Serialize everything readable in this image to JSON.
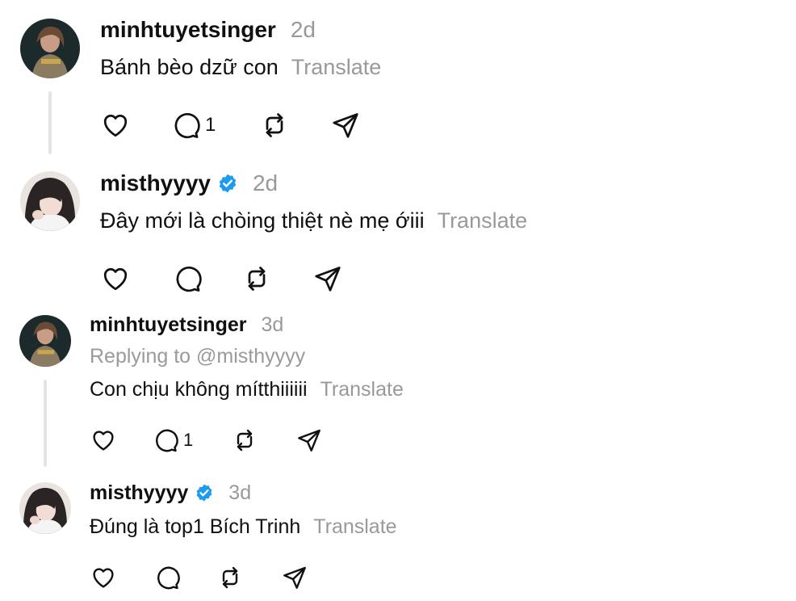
{
  "comments": [
    {
      "username": "minhtuyetsinger",
      "verified": false,
      "time": "2d",
      "text": "Bánh bèo dzữ con",
      "translate": "Translate",
      "reply_count": "1"
    },
    {
      "username": "misthyyyy",
      "verified": true,
      "time": "2d",
      "text": "Đây mới là chòing thiệt nè mẹ ớiii",
      "translate": "Translate",
      "reply_count": ""
    },
    {
      "username": "minhtuyetsinger",
      "verified": false,
      "time": "3d",
      "replying_to": "Replying to @misthyyyy",
      "text": "Con chịu không mítthiiiiii",
      "translate": "Translate",
      "reply_count": "1"
    },
    {
      "username": "misthyyyy",
      "verified": true,
      "time": "3d",
      "text": "Đúng là top1 Bích Trinh",
      "translate": "Translate",
      "reply_count": ""
    }
  ],
  "colors": {
    "verified_badge": "#1d9bf0",
    "muted_text": "#999999",
    "thread_line": "#e4e4e4"
  },
  "icons": [
    "heart-icon",
    "comment-icon",
    "repost-icon",
    "share-icon",
    "verified-badge-icon"
  ]
}
